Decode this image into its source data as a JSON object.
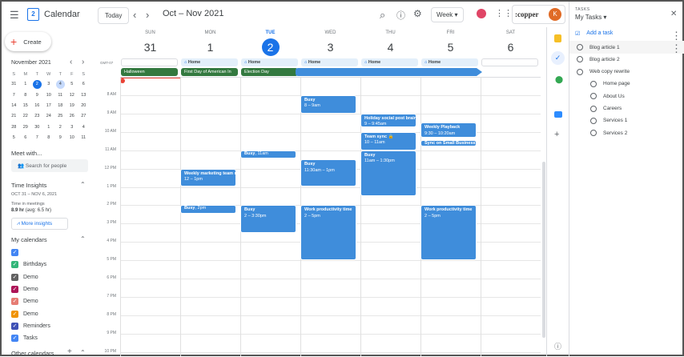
{
  "header": {
    "app_title": "Calendar",
    "logo_day": "2",
    "today_label": "Today",
    "date_range": "Oct – Nov 2021",
    "view_label": "Week",
    "copper_label": ":copper",
    "avatar_letter": "K"
  },
  "sidebar": {
    "create_label": "Create",
    "mini_cal": {
      "title": "November 2021",
      "dows": [
        "S",
        "M",
        "T",
        "W",
        "T",
        "F",
        "S"
      ],
      "weeks": [
        [
          "31",
          "1",
          "2",
          "3",
          "4",
          "5",
          "6"
        ],
        [
          "7",
          "8",
          "9",
          "10",
          "11",
          "12",
          "13"
        ],
        [
          "14",
          "15",
          "16",
          "17",
          "18",
          "19",
          "20"
        ],
        [
          "21",
          "22",
          "23",
          "24",
          "25",
          "26",
          "27"
        ],
        [
          "28",
          "29",
          "30",
          "1",
          "2",
          "3",
          "4"
        ],
        [
          "5",
          "6",
          "7",
          "8",
          "9",
          "10",
          "11"
        ]
      ],
      "today": "2",
      "selected": "4"
    },
    "meet_with": "Meet with...",
    "search_people": "Search for people",
    "insights_title": "Time Insights",
    "insights_range": "OCT 31 – NOV 6, 2021",
    "time_in_meetings": "Time in meetings",
    "insights_value": "8.9 hr",
    "insights_avg": "(avg: 6.5 hr)",
    "more_insights": "More insights",
    "my_calendars_title": "My calendars",
    "calendars": [
      {
        "label": "",
        "color": "#4285f4"
      },
      {
        "label": "Birthdays",
        "color": "#33b679"
      },
      {
        "label": "Demo",
        "color": "#616161"
      },
      {
        "label": "Demo",
        "color": "#ad1457"
      },
      {
        "label": "Demo",
        "color": "#e67c73"
      },
      {
        "label": "Demo",
        "color": "#f09300"
      },
      {
        "label": "Reminders",
        "color": "#3f51b5"
      },
      {
        "label": "Tasks",
        "color": "#4285f4"
      }
    ],
    "other_calendars_title": "Other calendars"
  },
  "week": {
    "timezone": "GMT-07",
    "days": [
      {
        "dow": "SUN",
        "num": "31"
      },
      {
        "dow": "MON",
        "num": "1"
      },
      {
        "dow": "TUE",
        "num": "2",
        "today": true
      },
      {
        "dow": "WED",
        "num": "3"
      },
      {
        "dow": "THU",
        "num": "4"
      },
      {
        "dow": "FRI",
        "num": "5"
      },
      {
        "dow": "SAT",
        "num": "6"
      }
    ],
    "hours": [
      "8 AM",
      "9 AM",
      "10 AM",
      "11 AM",
      "12 PM",
      "1 PM",
      "2 PM",
      "3 PM",
      "4 PM",
      "5 PM",
      "6 PM",
      "7 PM",
      "8 PM",
      "9 PM",
      "10 PM"
    ],
    "working_location": [
      {
        "day": 1,
        "label": "Home"
      },
      {
        "day": 2,
        "label": "Home"
      },
      {
        "day": 3,
        "label": "Home"
      },
      {
        "day": 4,
        "label": "Home"
      },
      {
        "day": 5,
        "label": "Home"
      }
    ],
    "all_day": [
      {
        "day": 0,
        "span": 1,
        "label": "Halloween"
      },
      {
        "day": 1,
        "span": 1,
        "label": "First Day of American In"
      },
      {
        "day": 2,
        "span": 1,
        "label": "Election Day"
      }
    ],
    "events": [
      {
        "day": 1,
        "start": 12,
        "end": 13,
        "title": "Weekly marketing team m",
        "time": "12 – 1pm"
      },
      {
        "day": 1,
        "start": 14,
        "end": 14.45,
        "title": "Busy",
        "time": ", 2pm",
        "inline": true
      },
      {
        "day": 2,
        "start": 11,
        "end": 11.45,
        "title": "Busy",
        "time": ", 11am",
        "inline": true
      },
      {
        "day": 2,
        "start": 14,
        "end": 15.5,
        "title": "Busy",
        "time": "2 – 3:30pm"
      },
      {
        "day": 3,
        "start": 8,
        "end": 9,
        "title": "Busy",
        "time": "8 – 9am"
      },
      {
        "day": 3,
        "start": 11.5,
        "end": 13,
        "title": "Busy",
        "time": "11:30am – 1pm"
      },
      {
        "day": 3,
        "start": 14,
        "end": 17,
        "title": "Work productivity time",
        "time": "2 – 5pm"
      },
      {
        "day": 4,
        "start": 9,
        "end": 9.75,
        "title": "Holiday social post brains",
        "time": "9 – 9:45am"
      },
      {
        "day": 4,
        "start": 10,
        "end": 11,
        "title": "Team sync 🔒",
        "time": "10 – 11am"
      },
      {
        "day": 4,
        "start": 11,
        "end": 13.5,
        "title": "Busy",
        "time": "11am – 1:30pm"
      },
      {
        "day": 5,
        "start": 9.5,
        "end": 10.33,
        "title": "Weekly Playback",
        "time": "9:30 – 10:20am"
      },
      {
        "day": 5,
        "start": 10.45,
        "end": 10.8,
        "title": "Sync on Small Business Sa",
        "time": "",
        "inline": true
      },
      {
        "day": 5,
        "start": 14,
        "end": 17,
        "title": "Work productivity time",
        "time": "2 – 5pm"
      }
    ],
    "now": {
      "day": 2,
      "hour": 21
    }
  },
  "tasks": {
    "section": "TASKS",
    "list_name": "My Tasks",
    "add_task": "Add a task",
    "items": [
      {
        "label": "Blog article 1",
        "indent": 0
      },
      {
        "label": "Blog article 2",
        "indent": 0
      },
      {
        "label": "Web copy rewrite",
        "indent": 0
      },
      {
        "label": "Home page",
        "indent": 1
      },
      {
        "label": "About Us",
        "indent": 1
      },
      {
        "label": "Careers",
        "indent": 1
      },
      {
        "label": "Services 1",
        "indent": 1
      },
      {
        "label": "Services 2",
        "indent": 1
      }
    ]
  },
  "colors": {
    "event": "#3f8ddb",
    "holiday": "#33793f",
    "today": "#1a73e8"
  }
}
